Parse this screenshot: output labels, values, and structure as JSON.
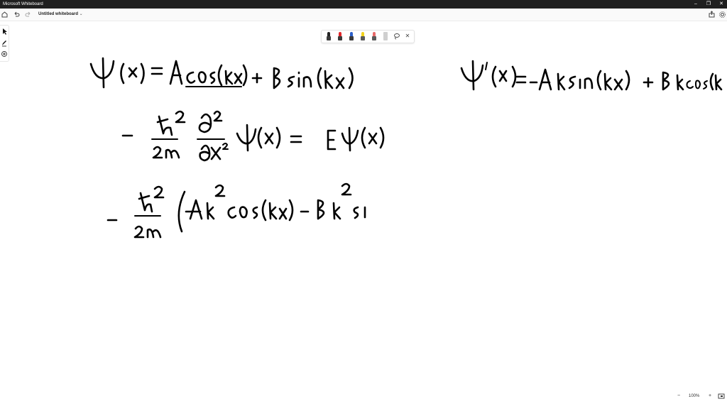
{
  "window": {
    "title": "Microsoft Whiteboard",
    "minimize_glyph": "–",
    "restore_glyph": "❐",
    "close_glyph": "✕"
  },
  "appbar": {
    "home_icon": "home-icon",
    "undo_icon": "undo-icon",
    "redo_icon": "redo-icon",
    "doc_title": "Untitled whiteboard",
    "share_icon": "share-icon",
    "settings_icon": "gear-icon"
  },
  "left_tools": [
    "select-icon",
    "pen-icon",
    "add-icon"
  ],
  "pen_tray": {
    "pens": [
      {
        "name": "black-pen",
        "color": "#222222"
      },
      {
        "name": "red-pen",
        "color": "#e0262a"
      },
      {
        "name": "blue-pen",
        "color": "#2b5fc9"
      },
      {
        "name": "yellow-highlighter",
        "color": "#f2d21b"
      },
      {
        "name": "red-highlighter",
        "color": "#e86a6a"
      },
      {
        "name": "eraser",
        "color": "#cfcfcf"
      }
    ],
    "lasso_icon": "lasso-icon",
    "close_glyph": "✕"
  },
  "statusbar": {
    "zoom_out_glyph": "−",
    "zoom_level": "100%",
    "zoom_in_glyph": "+",
    "minimap_icon": "minimap-icon"
  },
  "canvas": {
    "strokes_summary": "handwritten ink equations"
  }
}
